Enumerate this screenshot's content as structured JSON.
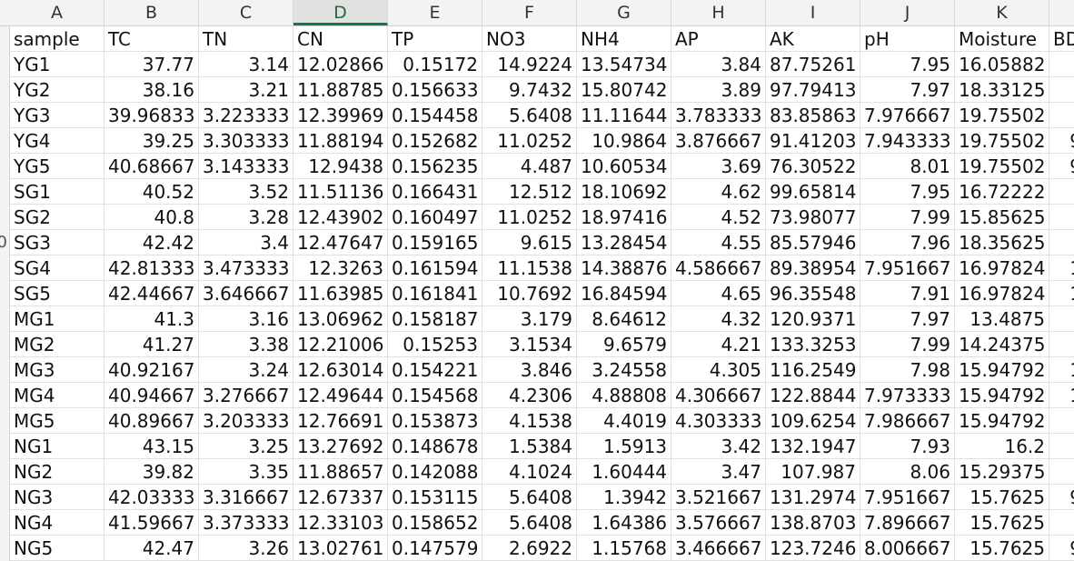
{
  "columns": [
    "A",
    "B",
    "C",
    "D",
    "E",
    "F",
    "G",
    "H",
    "I",
    "J",
    "K",
    ""
  ],
  "selected_column": "D",
  "row_numbers": [
    "",
    "",
    "",
    "",
    "",
    "",
    "",
    "",
    "0",
    "",
    "",
    "",
    "",
    "",
    "",
    "",
    "",
    "",
    "",
    "",
    ""
  ],
  "header": [
    "sample",
    "TC",
    "TN",
    "CN",
    "TP",
    "NO3",
    "NH4",
    "AP",
    "AK",
    "pH",
    "Moisture",
    "BD"
  ],
  "rows": [
    [
      "YG1",
      "37.77",
      "3.14",
      "12.02866",
      "0.15172",
      "14.9224",
      "13.54734",
      "3.84",
      "87.75261",
      "7.95",
      "16.05882",
      ""
    ],
    [
      "YG2",
      "38.16",
      "3.21",
      "11.88785",
      "0.156633",
      "9.7432",
      "15.80742",
      "3.89",
      "97.79413",
      "7.97",
      "18.33125",
      ""
    ],
    [
      "YG3",
      "39.96833",
      "3.223333",
      "12.39969",
      "0.154458",
      "5.6408",
      "11.11644",
      "3.783333",
      "83.85863",
      "7.976667",
      "19.75502",
      ""
    ],
    [
      "YG4",
      "39.25",
      "3.303333",
      "11.88194",
      "0.152682",
      "11.0252",
      "10.9864",
      "3.876667",
      "91.41203",
      "7.943333",
      "19.75502",
      "9"
    ],
    [
      "YG5",
      "40.68667",
      "3.143333",
      "12.9438",
      "0.156235",
      "4.487",
      "10.60534",
      "3.69",
      "76.30522",
      "8.01",
      "19.75502",
      "9"
    ],
    [
      "SG1",
      "40.52",
      "3.52",
      "11.51136",
      "0.166431",
      "12.512",
      "18.10692",
      "4.62",
      "99.65814",
      "7.95",
      "16.72222",
      ""
    ],
    [
      "SG2",
      "40.8",
      "3.28",
      "12.43902",
      "0.160497",
      "11.0252",
      "18.97416",
      "4.52",
      "73.98077",
      "7.99",
      "15.85625",
      ""
    ],
    [
      "SG3",
      "42.42",
      "3.4",
      "12.47647",
      "0.159165",
      "9.615",
      "13.28454",
      "4.55",
      "85.57946",
      "7.96",
      "18.35625",
      ""
    ],
    [
      "SG4",
      "42.81333",
      "3.473333",
      "12.3263",
      "0.161594",
      "11.1538",
      "14.38876",
      "4.586667",
      "89.38954",
      "7.951667",
      "16.97824",
      "1"
    ],
    [
      "SG5",
      "42.44667",
      "3.646667",
      "11.63985",
      "0.161841",
      "10.7692",
      "16.84594",
      "4.65",
      "96.35548",
      "7.91",
      "16.97824",
      "1"
    ],
    [
      "MG1",
      "41.3",
      "3.16",
      "13.06962",
      "0.158187",
      "3.179",
      "8.64612",
      "4.32",
      "120.9371",
      "7.97",
      "13.4875",
      ""
    ],
    [
      "MG2",
      "41.27",
      "3.38",
      "12.21006",
      "0.15253",
      "3.1534",
      "9.6579",
      "4.21",
      "133.3253",
      "7.99",
      "14.24375",
      ""
    ],
    [
      "MG3",
      "40.92167",
      "3.24",
      "12.63014",
      "0.154221",
      "3.846",
      "3.24558",
      "4.305",
      "116.2549",
      "7.98",
      "15.94792",
      "1"
    ],
    [
      "MG4",
      "40.94667",
      "3.276667",
      "12.49644",
      "0.154568",
      "4.2306",
      "4.88808",
      "4.306667",
      "122.8844",
      "7.973333",
      "15.94792",
      "1"
    ],
    [
      "MG5",
      "40.89667",
      "3.203333",
      "12.76691",
      "0.153873",
      "4.1538",
      "4.4019",
      "4.303333",
      "109.6254",
      "7.986667",
      "15.94792",
      ""
    ],
    [
      "NG1",
      "43.15",
      "3.25",
      "13.27692",
      "0.148678",
      "1.5384",
      "1.5913",
      "3.42",
      "132.1947",
      "7.93",
      "16.2",
      ""
    ],
    [
      "NG2",
      "39.82",
      "3.35",
      "11.88657",
      "0.142088",
      "4.1024",
      "1.60444",
      "3.47",
      "107.987",
      "8.06",
      "15.29375",
      ""
    ],
    [
      "NG3",
      "42.03333",
      "3.316667",
      "12.67337",
      "0.153115",
      "5.6408",
      "1.3942",
      "3.521667",
      "131.2974",
      "7.951667",
      "15.7625",
      "9"
    ],
    [
      "NG4",
      "41.59667",
      "3.373333",
      "12.33103",
      "0.158652",
      "5.6408",
      "1.64386",
      "3.576667",
      "138.8703",
      "7.896667",
      "15.7625",
      ""
    ],
    [
      "NG5",
      "42.47",
      "3.26",
      "13.02761",
      "0.147579",
      "2.6922",
      "1.15768",
      "3.466667",
      "123.7246",
      "8.006667",
      "15.7625",
      "9"
    ]
  ]
}
